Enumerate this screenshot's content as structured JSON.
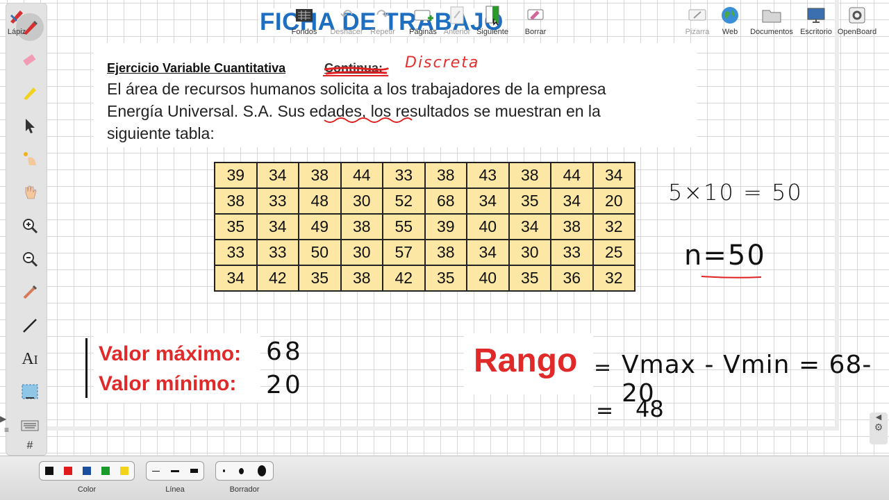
{
  "worksheet": {
    "title": "FICHA DE TRABAJO",
    "exercise_heading": "Ejercicio Variable Cuantitativa",
    "struck_word": "Continua:",
    "handwritten_type": "Discreta",
    "problem_text_line1": "El área de recursos humanos solicita a los trabajadores de la empresa",
    "problem_text_line2": "Energía Universal. S.A.  Sus edades, los resultados se muestran en la",
    "problem_text_line3": "siguiente tabla:",
    "table": [
      [
        "39",
        "34",
        "38",
        "44",
        "33",
        "38",
        "43",
        "38",
        "44",
        "34"
      ],
      [
        "38",
        "33",
        "48",
        "30",
        "52",
        "68",
        "34",
        "35",
        "34",
        "20"
      ],
      [
        "35",
        "34",
        "49",
        "38",
        "55",
        "39",
        "40",
        "34",
        "38",
        "32"
      ],
      [
        "33",
        "33",
        "50",
        "30",
        "57",
        "38",
        "34",
        "30",
        "33",
        "25"
      ],
      [
        "34",
        "42",
        "35",
        "38",
        "42",
        "35",
        "40",
        "35",
        "36",
        "32"
      ]
    ],
    "table_color": "#fde7a4",
    "note_product": "5×10 = 50",
    "note_n": "n=50",
    "label_max": "Valor máximo:",
    "label_min": "Valor mínimo:",
    "value_max": "68",
    "value_min": "20",
    "rango_label": "Rango",
    "rango_eq": "=",
    "rango_formula_vmax": "Vmax",
    "rango_formula_rest": "= 68-20",
    "rango_formula_vmin": "Vmin",
    "rango_result_eq": "=",
    "rango_result": "48",
    "accent_color": "#e02a2a",
    "title_color": "#1f6fc0"
  },
  "palette": {
    "tools": [
      "pen-icon",
      "eraser-icon",
      "highlighter-icon",
      "pointer-icon",
      "laser-icon",
      "hand-icon",
      "zoom-in-icon",
      "zoom-out-icon",
      "capture-icon",
      "line-icon",
      "text-icon",
      "screenshot-icon",
      "keyboard-icon"
    ]
  },
  "bottombar": {
    "lapiz": "Lápiz",
    "color": "Color",
    "linea": "Línea",
    "borrador": "Borrador",
    "fondos": "Fondos",
    "deshacer": "Deshacer",
    "repetir": "Repetir",
    "paginas": "Páginas",
    "anterior": "Anterior",
    "siguiente": "Siguiente",
    "borrar": "Borrar",
    "pizarra": "Pizarra",
    "web": "Web",
    "documentos": "Documentos",
    "escritorio": "Escritorio",
    "openboard": "OpenBoard",
    "colors": [
      "#111111",
      "#e01a1a",
      "#1a4fa0",
      "#1a9a2a",
      "#f2d21a"
    ]
  }
}
